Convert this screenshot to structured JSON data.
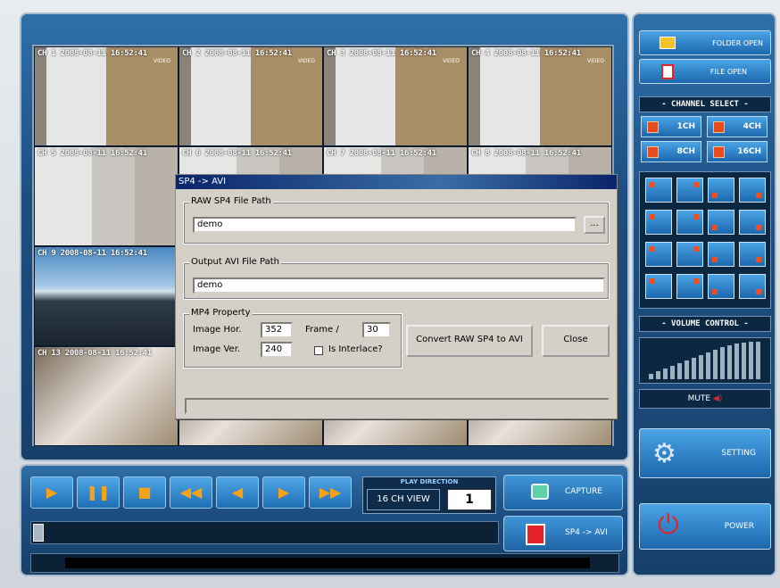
{
  "video": {
    "channels": [
      {
        "label": "CH 1 2008-08-11 16:52:41",
        "sub": "VIDEO"
      },
      {
        "label": "CH 2 2008-08-11 16:52:41",
        "sub": "VIDEO"
      },
      {
        "label": "CH 3 2008-08-11 16:52:41",
        "sub": "VIDEO"
      },
      {
        "label": "CH 4 2008-08-11 16:52:41",
        "sub": "VIDEO"
      },
      {
        "label": "CH 5 2008-08-11 16:52:41"
      },
      {
        "label": "CH 6 2008-08-11 16:52:41"
      },
      {
        "label": "CH 7 2008-08-11 16:52:41"
      },
      {
        "label": "CH 8 2008-08-11 16:52:41"
      },
      {
        "label": "CH 9 2008-08-11 16:52:41"
      },
      {
        "label": "CH 13 2008-08-11 16:52:41"
      }
    ]
  },
  "dialog": {
    "title": "SP4 -> AVI",
    "raw_group": "RAW SP4 File Path",
    "raw_value": "demo",
    "browse_label": "...",
    "output_group": "Output AVI File Path",
    "output_value": "demo",
    "mp4_group": "MP4 Property",
    "image_hor_label": "Image Hor.",
    "image_hor_value": "352",
    "frame_label": "Frame /",
    "frame_value": "30",
    "image_ver_label": "Image Ver.",
    "image_ver_value": "240",
    "interlace_label": "Is Interlace?",
    "convert_label": "Convert RAW SP4 to AVI",
    "close_label": "Close"
  },
  "controls": {
    "play_direction_title": "PLAY DIRECTION",
    "view_label": "16 CH VIEW",
    "view_number": "1",
    "capture_label": "CAPTURE",
    "sp4_avi_label": "SP4 -> AVI"
  },
  "right": {
    "folder_open": "FOLDER OPEN",
    "file_open": "FILE OPEN",
    "channel_select": "- CHANNEL SELECT -",
    "ch1": "1CH",
    "ch4": "4CH",
    "ch8": "8CH",
    "ch16": "16CH",
    "volume_control": "- VOLUME CONTROL -",
    "mute": "MUTE",
    "setting": "SETTING",
    "power": "POWER"
  },
  "colors": {
    "accent": "#1d4f82",
    "mark": "#f04e1c"
  }
}
